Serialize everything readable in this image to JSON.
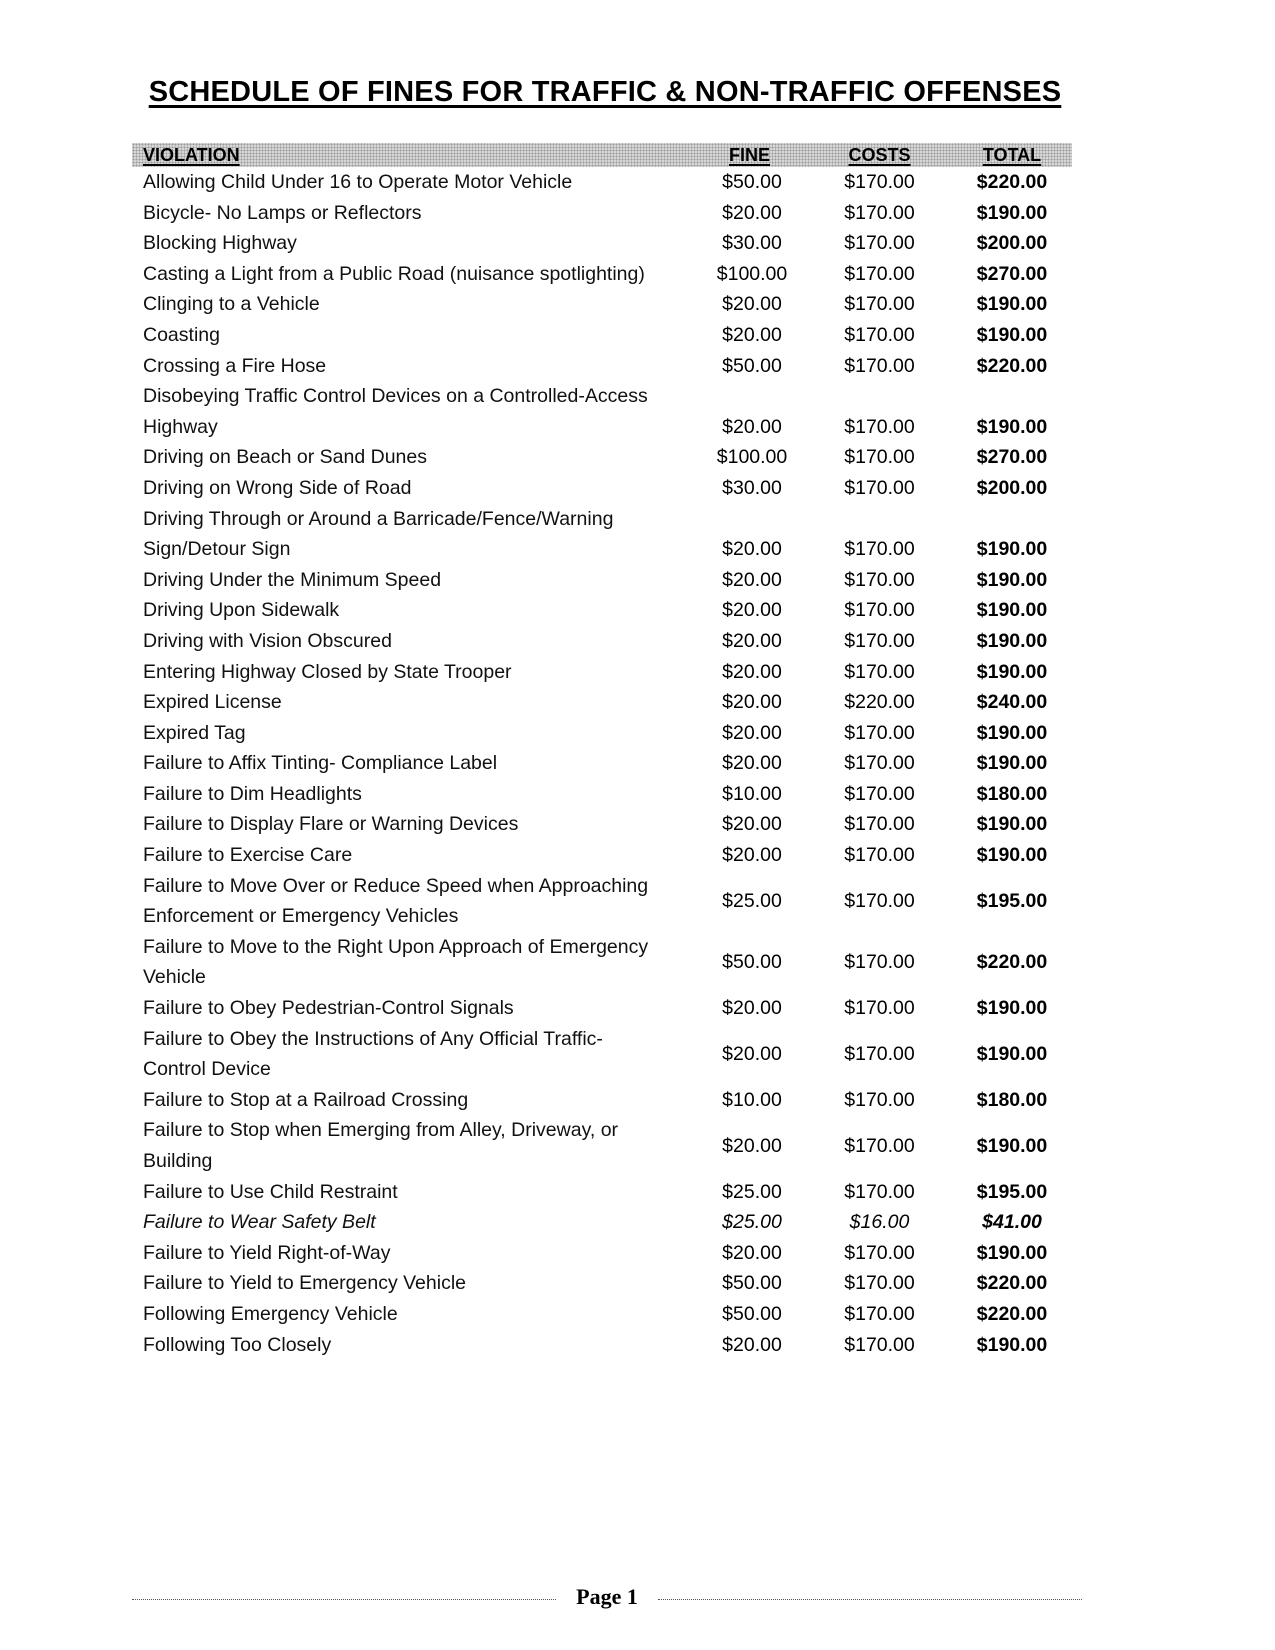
{
  "document": {
    "title": "SCHEDULE OF FINES FOR TRAFFIC & NON-TRAFFIC OFFENSES",
    "page_label": "Page 1"
  },
  "table": {
    "headers": {
      "violation": "VIOLATION",
      "fine": "FINE",
      "costs": "COSTS",
      "total": "TOTAL"
    },
    "header_fill_color": "#d6d6d6",
    "rows": [
      {
        "violation": "Allowing Child Under 16 to Operate Motor Vehicle",
        "fine": "$50.00",
        "costs": "$170.00",
        "total": "$220.00"
      },
      {
        "violation": "Bicycle- No Lamps or Reflectors",
        "fine": "$20.00",
        "costs": "$170.00",
        "total": "$190.00"
      },
      {
        "violation": "Blocking Highway",
        "fine": "$30.00",
        "costs": "$170.00",
        "total": "$200.00"
      },
      {
        "violation": "Casting a Light from a Public Road (nuisance spotlighting)",
        "fine": "$100.00",
        "costs": "$170.00",
        "total": "$270.00"
      },
      {
        "violation": "Clinging to a Vehicle",
        "fine": "$20.00",
        "costs": "$170.00",
        "total": "$190.00"
      },
      {
        "violation": "Coasting",
        "fine": "$20.00",
        "costs": "$170.00",
        "total": "$190.00"
      },
      {
        "violation": "Crossing a Fire Hose",
        "fine": "$50.00",
        "costs": "$170.00",
        "total": "$220.00"
      },
      {
        "violation": "Disobeying Traffic Control Devices on a Controlled-Access Highway",
        "fine": "$20.00",
        "costs": "$170.00",
        "total": "$190.00"
      },
      {
        "violation": "Driving on Beach or Sand Dunes",
        "fine": "$100.00",
        "costs": "$170.00",
        "total": "$270.00"
      },
      {
        "violation": "Driving on Wrong Side of Road",
        "fine": "$30.00",
        "costs": "$170.00",
        "total": "$200.00"
      },
      {
        "violation": "Driving Through or Around a Barricade/Fence/Warning Sign/Detour Sign",
        "fine": "$20.00",
        "costs": "$170.00",
        "total": "$190.00"
      },
      {
        "violation": "Driving Under the Minimum Speed",
        "fine": "$20.00",
        "costs": "$170.00",
        "total": "$190.00"
      },
      {
        "violation": "Driving Upon Sidewalk",
        "fine": "$20.00",
        "costs": "$170.00",
        "total": "$190.00"
      },
      {
        "violation": "Driving with Vision Obscured",
        "fine": "$20.00",
        "costs": "$170.00",
        "total": "$190.00"
      },
      {
        "violation": "Entering Highway Closed by State Trooper",
        "fine": "$20.00",
        "costs": "$170.00",
        "total": "$190.00"
      },
      {
        "violation": "Expired License",
        "fine": "$20.00",
        "costs": "$220.00",
        "total": "$240.00"
      },
      {
        "violation": "Expired Tag",
        "fine": "$20.00",
        "costs": "$170.00",
        "total": "$190.00"
      },
      {
        "violation": "Failure to Affix Tinting- Compliance Label",
        "fine": "$20.00",
        "costs": "$170.00",
        "total": "$190.00"
      },
      {
        "violation": "Failure to Dim Headlights",
        "fine": "$10.00",
        "costs": "$170.00",
        "total": "$180.00"
      },
      {
        "violation": "Failure to Display Flare or Warning Devices",
        "fine": "$20.00",
        "costs": "$170.00",
        "total": "$190.00"
      },
      {
        "violation": "Failure to Exercise Care",
        "fine": "$20.00",
        "costs": "$170.00",
        "total": "$190.00"
      },
      {
        "violation": "Failure to Move Over or Reduce Speed when Approaching Enforcement or Emergency Vehicles",
        "fine": "$25.00",
        "costs": "$170.00",
        "total": "$195.00"
      },
      {
        "violation": "Failure to Move to the Right Upon Approach of Emergency Vehicle",
        "fine": "$50.00",
        "costs": "$170.00",
        "total": "$220.00"
      },
      {
        "violation": "Failure to Obey Pedestrian-Control Signals",
        "fine": "$20.00",
        "costs": "$170.00",
        "total": "$190.00"
      },
      {
        "violation": "Failure to Obey the Instructions of Any Official Traffic-Control Device",
        "fine": "$20.00",
        "costs": "$170.00",
        "total": "$190.00"
      },
      {
        "violation": "Failure to Stop at a Railroad Crossing",
        "fine": "$10.00",
        "costs": "$170.00",
        "total": "$180.00"
      },
      {
        "violation": "Failure to Stop when Emerging from Alley, Driveway, or Building",
        "fine": "$20.00",
        "costs": "$170.00",
        "total": "$190.00"
      },
      {
        "violation": "Failure to Use Child Restraint",
        "fine": "$25.00",
        "costs": "$170.00",
        "total": "$195.00"
      },
      {
        "violation": "Failure to Wear Safety Belt",
        "fine": "$25.00",
        "costs": "$16.00",
        "total": "$41.00",
        "italic": true
      },
      {
        "violation": "Failure to Yield Right-of-Way",
        "fine": "$20.00",
        "costs": "$170.00",
        "total": "$190.00"
      },
      {
        "violation": "Failure to Yield to Emergency Vehicle",
        "fine": "$50.00",
        "costs": "$170.00",
        "total": "$220.00"
      },
      {
        "violation": "Following Emergency Vehicle",
        "fine": "$50.00",
        "costs": "$170.00",
        "total": "$220.00"
      },
      {
        "violation": "Following Too Closely",
        "fine": "$20.00",
        "costs": "$170.00",
        "total": "$190.00"
      }
    ]
  }
}
